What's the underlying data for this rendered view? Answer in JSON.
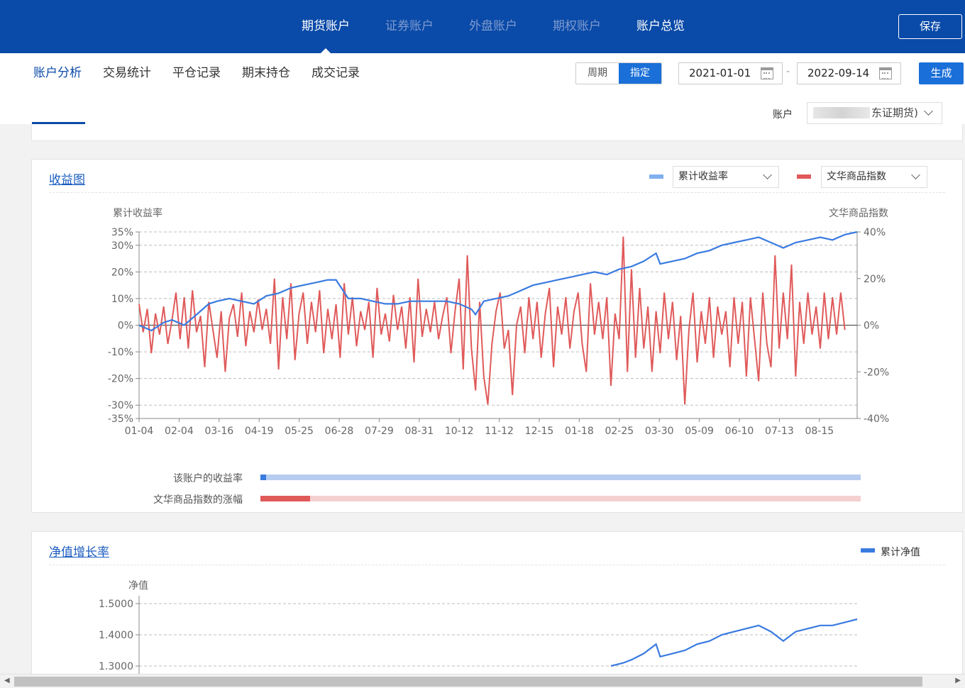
{
  "nav": {
    "tabs": [
      {
        "label": "期货账户"
      },
      {
        "label": "证券账户"
      },
      {
        "label": "外盘账户"
      },
      {
        "label": "期权账户"
      },
      {
        "label": "账户总览"
      }
    ],
    "save_label": "保存"
  },
  "subnav": {
    "tabs": [
      {
        "label": "账户分析"
      },
      {
        "label": "交易统计"
      },
      {
        "label": "平仓记录"
      },
      {
        "label": "期末持仓"
      },
      {
        "label": "成交记录"
      }
    ],
    "period_options": [
      "周期",
      "指定"
    ],
    "start_date": "2021-01-01",
    "date_separator": "-",
    "end_date": "2022-09-14",
    "generate_label": "生成",
    "account_label": "账户",
    "account_value": "东证期货)"
  },
  "returns_card": {
    "title": "收益图",
    "legend_left": "累计收益率",
    "legend_right": "文华商品指数",
    "colors": {
      "blue": "#3a7be0",
      "red": "#e05a5a",
      "blue_light": "#b7cdf0",
      "red_light": "#f5d0d0"
    },
    "bar_rows": [
      {
        "label": "该账户的收益率",
        "fill": 0.01
      },
      {
        "label": "文华商品指数的涨幅",
        "fill": 0.083
      }
    ]
  },
  "nav_card": {
    "title": "净值增长率",
    "legend": "累计净值"
  },
  "chart_data": [
    {
      "type": "line",
      "ylabel_left": "累计收益率",
      "ylabel_right": "文华商品指数",
      "x_ticks": [
        "01-04",
        "02-04",
        "03-16",
        "04-19",
        "05-25",
        "06-28",
        "07-29",
        "08-31",
        "10-12",
        "11-12",
        "12-15",
        "01-18",
        "02-25",
        "03-30",
        "05-09",
        "06-10",
        "07-13",
        "08-15"
      ],
      "y_left_ticks": [
        "35%",
        "30%",
        "20%",
        "10%",
        "0%",
        "-10%",
        "-20%",
        "-30%",
        "-35%"
      ],
      "y_left_values": [
        35,
        30,
        20,
        10,
        0,
        -10,
        -20,
        -30,
        -35
      ],
      "y_right_ticks": [
        "40%",
        "20%",
        "0%",
        "-20%",
        "-40%"
      ],
      "y_right_values": [
        40,
        20,
        0,
        -20,
        -40
      ],
      "ylim_left": [
        -35,
        35
      ],
      "ylim_right": [
        -40,
        40
      ],
      "grid": "dashed horizontal",
      "series": [
        {
          "name": "累计收益率",
          "axis": "left",
          "points": [
            [
              0,
              0
            ],
            [
              3,
              -2
            ],
            [
              6,
              1
            ],
            [
              8,
              2
            ],
            [
              11,
              0
            ],
            [
              14,
              4
            ],
            [
              17,
              8
            ],
            [
              19,
              9
            ],
            [
              22,
              10
            ],
            [
              25,
              9
            ],
            [
              28,
              8
            ],
            [
              31,
              11
            ],
            [
              34,
              12
            ],
            [
              37,
              14
            ],
            [
              40,
              15
            ],
            [
              43,
              16
            ],
            [
              46,
              17
            ],
            [
              48,
              17
            ],
            [
              51,
              10
            ],
            [
              54,
              10
            ],
            [
              57,
              9
            ],
            [
              60,
              8
            ],
            [
              63,
              8
            ],
            [
              66,
              9
            ],
            [
              69,
              9
            ],
            [
              72,
              9
            ],
            [
              75,
              9
            ],
            [
              78,
              8
            ],
            [
              81,
              6
            ],
            [
              82,
              4
            ],
            [
              84,
              9
            ],
            [
              87,
              10
            ],
            [
              90,
              11
            ],
            [
              93,
              13
            ],
            [
              96,
              15
            ],
            [
              99,
              16
            ],
            [
              102,
              17
            ],
            [
              105,
              18
            ],
            [
              108,
              19
            ],
            [
              111,
              20
            ],
            [
              114,
              19
            ],
            [
              117,
              21
            ],
            [
              120,
              22
            ],
            [
              123,
              24
            ],
            [
              126,
              27
            ],
            [
              127,
              23
            ],
            [
              130,
              24
            ],
            [
              133,
              25
            ],
            [
              136,
              27
            ],
            [
              139,
              28
            ],
            [
              142,
              30
            ],
            [
              145,
              31
            ],
            [
              148,
              32
            ],
            [
              151,
              33
            ],
            [
              154,
              31
            ],
            [
              157,
              29
            ],
            [
              160,
              31
            ],
            [
              163,
              32
            ],
            [
              166,
              33
            ],
            [
              169,
              32
            ],
            [
              172,
              34
            ],
            [
              175,
              35
            ]
          ]
        },
        {
          "name": "文华商品指数",
          "axis": "right",
          "points": [
            [
              0,
              9
            ],
            [
              1,
              -3
            ],
            [
              2,
              7
            ],
            [
              3,
              -12
            ],
            [
              4,
              5
            ],
            [
              5,
              -4
            ],
            [
              6,
              8
            ],
            [
              7,
              -8
            ],
            [
              8,
              2
            ],
            [
              9,
              14
            ],
            [
              10,
              -6
            ],
            [
              11,
              12
            ],
            [
              12,
              -10
            ],
            [
              13,
              15
            ],
            [
              14,
              -3
            ],
            [
              15,
              4
            ],
            [
              16,
              -18
            ],
            [
              17,
              10
            ],
            [
              18,
              -2
            ],
            [
              19,
              -14
            ],
            [
              20,
              6
            ],
            [
              21,
              -20
            ],
            [
              22,
              3
            ],
            [
              23,
              9
            ],
            [
              24,
              -5
            ],
            [
              25,
              14
            ],
            [
              26,
              -9
            ],
            [
              27,
              6
            ],
            [
              28,
              -3
            ],
            [
              29,
              11
            ],
            [
              30,
              -2
            ],
            [
              31,
              7
            ],
            [
              32,
              -8
            ],
            [
              33,
              20
            ],
            [
              34,
              -19
            ],
            [
              35,
              12
            ],
            [
              36,
              -6
            ],
            [
              37,
              18
            ],
            [
              38,
              -15
            ],
            [
              39,
              5
            ],
            [
              40,
              14
            ],
            [
              41,
              -8
            ],
            [
              42,
              10
            ],
            [
              43,
              -3
            ],
            [
              44,
              15
            ],
            [
              45,
              -12
            ],
            [
              46,
              7
            ],
            [
              47,
              -6
            ],
            [
              48,
              9
            ],
            [
              49,
              -14
            ],
            [
              50,
              18
            ],
            [
              51,
              -4
            ],
            [
              52,
              12
            ],
            [
              53,
              -9
            ],
            [
              54,
              6
            ],
            [
              55,
              -2
            ],
            [
              56,
              10
            ],
            [
              57,
              -14
            ],
            [
              58,
              16
            ],
            [
              59,
              -4
            ],
            [
              60,
              5
            ],
            [
              61,
              -7
            ],
            [
              62,
              13
            ],
            [
              63,
              -2
            ],
            [
              64,
              8
            ],
            [
              65,
              -10
            ],
            [
              66,
              12
            ],
            [
              67,
              -16
            ],
            [
              68,
              20
            ],
            [
              69,
              -5
            ],
            [
              70,
              7
            ],
            [
              71,
              -3
            ],
            [
              72,
              10
            ],
            [
              73,
              -6
            ],
            [
              74,
              4
            ],
            [
              75,
              12
            ],
            [
              76,
              -12
            ],
            [
              77,
              6
            ],
            [
              78,
              20
            ],
            [
              79,
              -19
            ],
            [
              80,
              30
            ],
            [
              81,
              -10
            ],
            [
              82,
              -28
            ],
            [
              83,
              10
            ],
            [
              84,
              -22
            ],
            [
              85,
              -34
            ],
            [
              86,
              -8
            ],
            [
              87,
              6
            ],
            [
              88,
              14
            ],
            [
              89,
              -10
            ],
            [
              90,
              -2
            ],
            [
              91,
              -30
            ],
            [
              92,
              0
            ],
            [
              93,
              8
            ],
            [
              94,
              -12
            ],
            [
              95,
              12
            ],
            [
              96,
              -6
            ],
            [
              97,
              10
            ],
            [
              98,
              -14
            ],
            [
              99,
              5
            ],
            [
              100,
              16
            ],
            [
              101,
              -18
            ],
            [
              102,
              8
            ],
            [
              103,
              -4
            ],
            [
              104,
              12
            ],
            [
              105,
              -10
            ],
            [
              106,
              6
            ],
            [
              107,
              14
            ],
            [
              108,
              -8
            ],
            [
              109,
              -20
            ],
            [
              110,
              18
            ],
            [
              111,
              -4
            ],
            [
              112,
              10
            ],
            [
              113,
              -6
            ],
            [
              114,
              12
            ],
            [
              115,
              -26
            ],
            [
              116,
              5
            ],
            [
              117,
              -6
            ],
            [
              118,
              38
            ],
            [
              119,
              -20
            ],
            [
              120,
              24
            ],
            [
              121,
              -14
            ],
            [
              122,
              16
            ],
            [
              123,
              -10
            ],
            [
              124,
              8
            ],
            [
              125,
              -20
            ],
            [
              126,
              6
            ],
            [
              127,
              -12
            ],
            [
              128,
              14
            ],
            [
              129,
              -6
            ],
            [
              130,
              10
            ],
            [
              131,
              -15
            ],
            [
              132,
              4
            ],
            [
              133,
              -34
            ],
            [
              134,
              -2
            ],
            [
              135,
              14
            ],
            [
              136,
              -16
            ],
            [
              137,
              6
            ],
            [
              138,
              -8
            ],
            [
              139,
              12
            ],
            [
              140,
              -14
            ],
            [
              141,
              8
            ],
            [
              142,
              -4
            ],
            [
              143,
              6
            ],
            [
              144,
              -18
            ],
            [
              145,
              12
            ],
            [
              146,
              -8
            ],
            [
              147,
              10
            ],
            [
              148,
              -22
            ],
            [
              149,
              12
            ],
            [
              150,
              -6
            ],
            [
              151,
              -24
            ],
            [
              152,
              14
            ],
            [
              153,
              -8
            ],
            [
              154,
              -18
            ],
            [
              155,
              30
            ],
            [
              156,
              -10
            ],
            [
              157,
              14
            ],
            [
              158,
              -6
            ],
            [
              159,
              26
            ],
            [
              160,
              -22
            ],
            [
              161,
              10
            ],
            [
              162,
              -8
            ],
            [
              163,
              14
            ],
            [
              164,
              -4
            ],
            [
              165,
              8
            ],
            [
              166,
              -10
            ],
            [
              167,
              14
            ],
            [
              168,
              -6
            ],
            [
              169,
              12
            ],
            [
              170,
              -4
            ],
            [
              171,
              14
            ],
            [
              172,
              -2
            ]
          ]
        }
      ]
    },
    {
      "type": "line",
      "ylabel": "净值",
      "y_ticks": [
        "1.5000",
        "1.4000",
        "1.3000"
      ],
      "y_values": [
        1.5,
        1.4,
        1.3
      ],
      "grid": "dashed horizontal",
      "series": [
        {
          "name": "累计净值",
          "points": [
            [
              115,
              1.3
            ],
            [
              118,
              1.31
            ],
            [
              120,
              1.32
            ],
            [
              123,
              1.34
            ],
            [
              126,
              1.37
            ],
            [
              127,
              1.33
            ],
            [
              130,
              1.34
            ],
            [
              133,
              1.35
            ],
            [
              136,
              1.37
            ],
            [
              139,
              1.38
            ],
            [
              142,
              1.4
            ],
            [
              145,
              1.41
            ],
            [
              148,
              1.42
            ],
            [
              151,
              1.43
            ],
            [
              154,
              1.41
            ],
            [
              157,
              1.38
            ],
            [
              160,
              1.41
            ],
            [
              163,
              1.42
            ],
            [
              166,
              1.43
            ],
            [
              169,
              1.43
            ],
            [
              172,
              1.44
            ],
            [
              175,
              1.45
            ]
          ]
        }
      ]
    }
  ]
}
